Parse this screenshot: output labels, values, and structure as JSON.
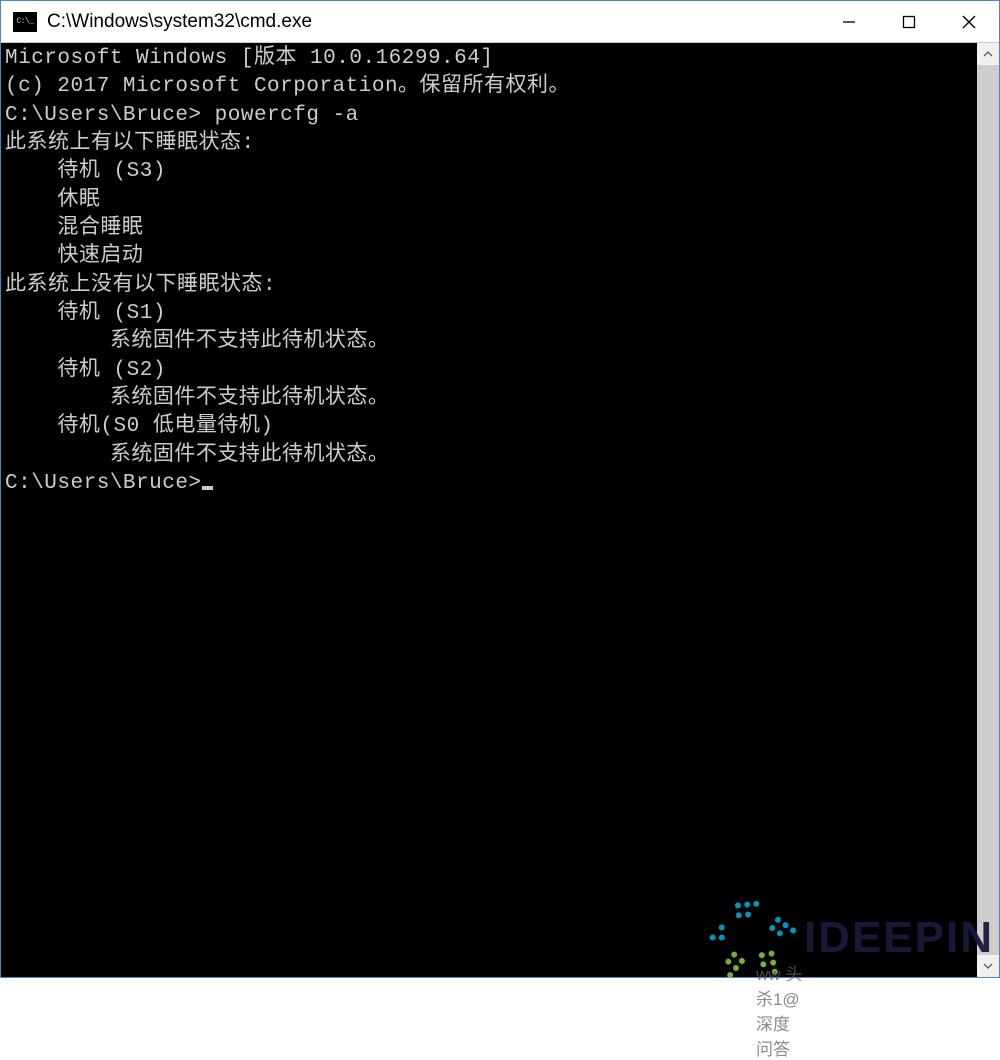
{
  "window": {
    "title": "C:\\Windows\\system32\\cmd.exe"
  },
  "terminal": {
    "header1": "Microsoft Windows [版本 10.0.16299.64]",
    "header2": "(c) 2017 Microsoft Corporation。保留所有权利。",
    "blank": "",
    "prompt1": "C:\\Users\\Bruce> powercfg -a",
    "avail_header": "此系统上有以下睡眠状态:",
    "avail1": "    待机 (S3)",
    "avail2": "    休眠",
    "avail3": "    混合睡眠",
    "avail4": "    快速启动",
    "unavail_header": "此系统上没有以下睡眠状态:",
    "u1": "    待机 (S1)",
    "u1r": "        系统固件不支持此待机状态。",
    "u2": "    待机 (S2)",
    "u2r": "        系统固件不支持此待机状态。",
    "u3": "    待机(S0 低电量待机)",
    "u3r": "        系统固件不支持此待机状态。",
    "prompt2": "C:\\Users\\Bruce>"
  },
  "watermark": {
    "brand": "IDEEPIN",
    "sub_overlay": "ww 头杀1@深度问答"
  }
}
